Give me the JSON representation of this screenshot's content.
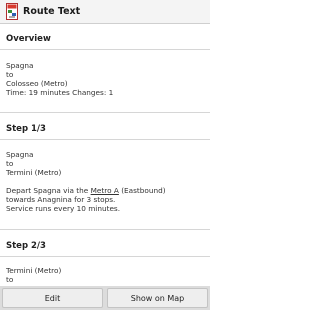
{
  "header": {
    "title": "Route Text",
    "icon": "route-map-icon"
  },
  "overview": {
    "heading": "Overview",
    "from": "Spagna",
    "to_word": "to",
    "destination": "Colosseo (Metro)",
    "summary": "Time: 19 minutes Changes: 1"
  },
  "steps": [
    {
      "heading": "Step 1/3",
      "from": "Spagna",
      "to_word": "to",
      "destination": "Termini (Metro)",
      "depart_prefix": "Depart Spagna via the ",
      "line_link": "Metro A",
      "depart_suffix": " (Eastbound)",
      "towards": "towards Anagnina for 3 stops.",
      "service": "Service runs every 10 minutes."
    },
    {
      "heading": "Step 2/3",
      "from": "Termini (Metro)",
      "to_word": "to"
    }
  ],
  "footer": {
    "edit_label": "Edit",
    "show_on_map_label": "Show on Map"
  }
}
